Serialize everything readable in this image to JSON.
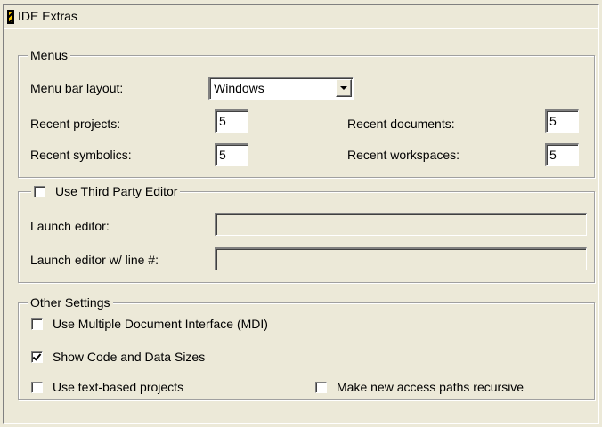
{
  "panel": {
    "title": "IDE Extras"
  },
  "menus": {
    "legend": "Menus",
    "menu_bar_layout_label": "Menu bar layout:",
    "menu_bar_layout_value": "Windows",
    "recent_projects_label": "Recent projects:",
    "recent_projects_value": "5",
    "recent_symbolics_label": "Recent symbolics:",
    "recent_symbolics_value": "5",
    "recent_documents_label": "Recent documents:",
    "recent_documents_value": "5",
    "recent_workspaces_label": "Recent workspaces:",
    "recent_workspaces_value": "5"
  },
  "third_party_editor": {
    "legend": "Use Third Party Editor",
    "enabled": false,
    "launch_editor_label": "Launch editor:",
    "launch_editor_value": "",
    "launch_editor_line_label": "Launch editor w/ line #:",
    "launch_editor_line_value": ""
  },
  "other_settings": {
    "legend": "Other Settings",
    "use_mdi_label": "Use Multiple Document Interface (MDI)",
    "use_mdi_checked": false,
    "show_sizes_label": "Show Code and Data Sizes",
    "show_sizes_checked": true,
    "text_projects_label": "Use text-based projects",
    "text_projects_checked": false,
    "recursive_paths_label": "Make new access paths recursive",
    "recursive_paths_checked": false
  }
}
